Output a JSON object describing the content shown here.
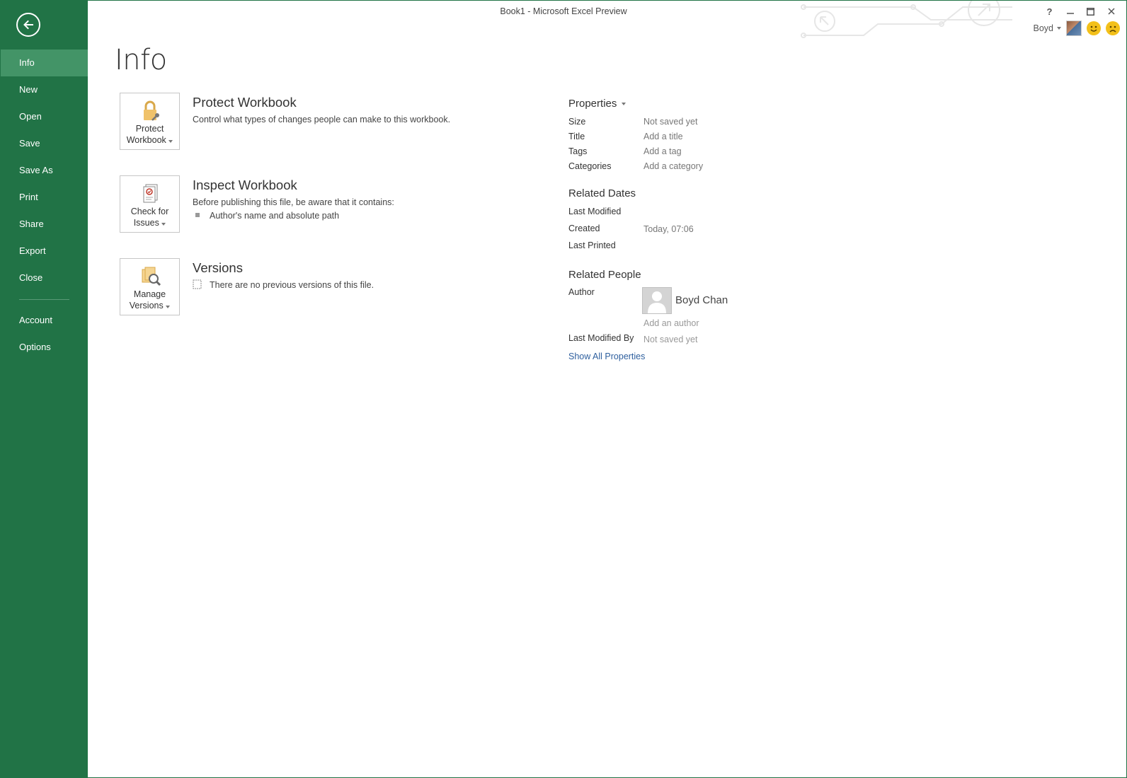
{
  "window": {
    "title": "Book1 - Microsoft Excel Preview",
    "help": "?",
    "user_name": "Boyd"
  },
  "sidebar": {
    "items": [
      {
        "label": "Info",
        "active": true
      },
      {
        "label": "New"
      },
      {
        "label": "Open"
      },
      {
        "label": "Save"
      },
      {
        "label": "Save As"
      },
      {
        "label": "Print"
      },
      {
        "label": "Share"
      },
      {
        "label": "Export"
      },
      {
        "label": "Close"
      },
      {
        "label": "Account"
      },
      {
        "label": "Options"
      }
    ]
  },
  "page": {
    "title": "Info"
  },
  "sections": {
    "protect": {
      "button_line1": "Protect",
      "button_line2": "Workbook",
      "heading": "Protect Workbook",
      "description": "Control what types of changes people can make to this workbook."
    },
    "inspect": {
      "button_line1": "Check for",
      "button_line2": "Issues",
      "heading": "Inspect Workbook",
      "description": "Before publishing this file, be aware that it contains:",
      "item": "Author's name and absolute path"
    },
    "versions": {
      "button_line1": "Manage",
      "button_line2": "Versions",
      "heading": "Versions",
      "description": "There are no previous versions of this file."
    }
  },
  "properties": {
    "heading": "Properties",
    "rows": [
      {
        "label": "Size",
        "value": "Not saved yet"
      },
      {
        "label": "Title",
        "value": "Add a title"
      },
      {
        "label": "Tags",
        "value": "Add a tag"
      },
      {
        "label": "Categories",
        "value": "Add a category"
      }
    ],
    "related_dates": {
      "heading": "Related Dates",
      "last_modified_label": "Last Modified",
      "created_label": "Created",
      "created_value": "Today, 07:06",
      "last_printed_label": "Last Printed"
    },
    "related_people": {
      "heading": "Related People",
      "author_label": "Author",
      "author_name": "Boyd Chan",
      "add_author": "Add an author",
      "last_modified_by_label": "Last Modified By",
      "last_modified_by_value": "Not saved yet"
    },
    "show_all": "Show All Properties"
  },
  "colors": {
    "sidebar": "#217346",
    "sidebar_active": "#439467",
    "link": "#2e5f9e"
  }
}
